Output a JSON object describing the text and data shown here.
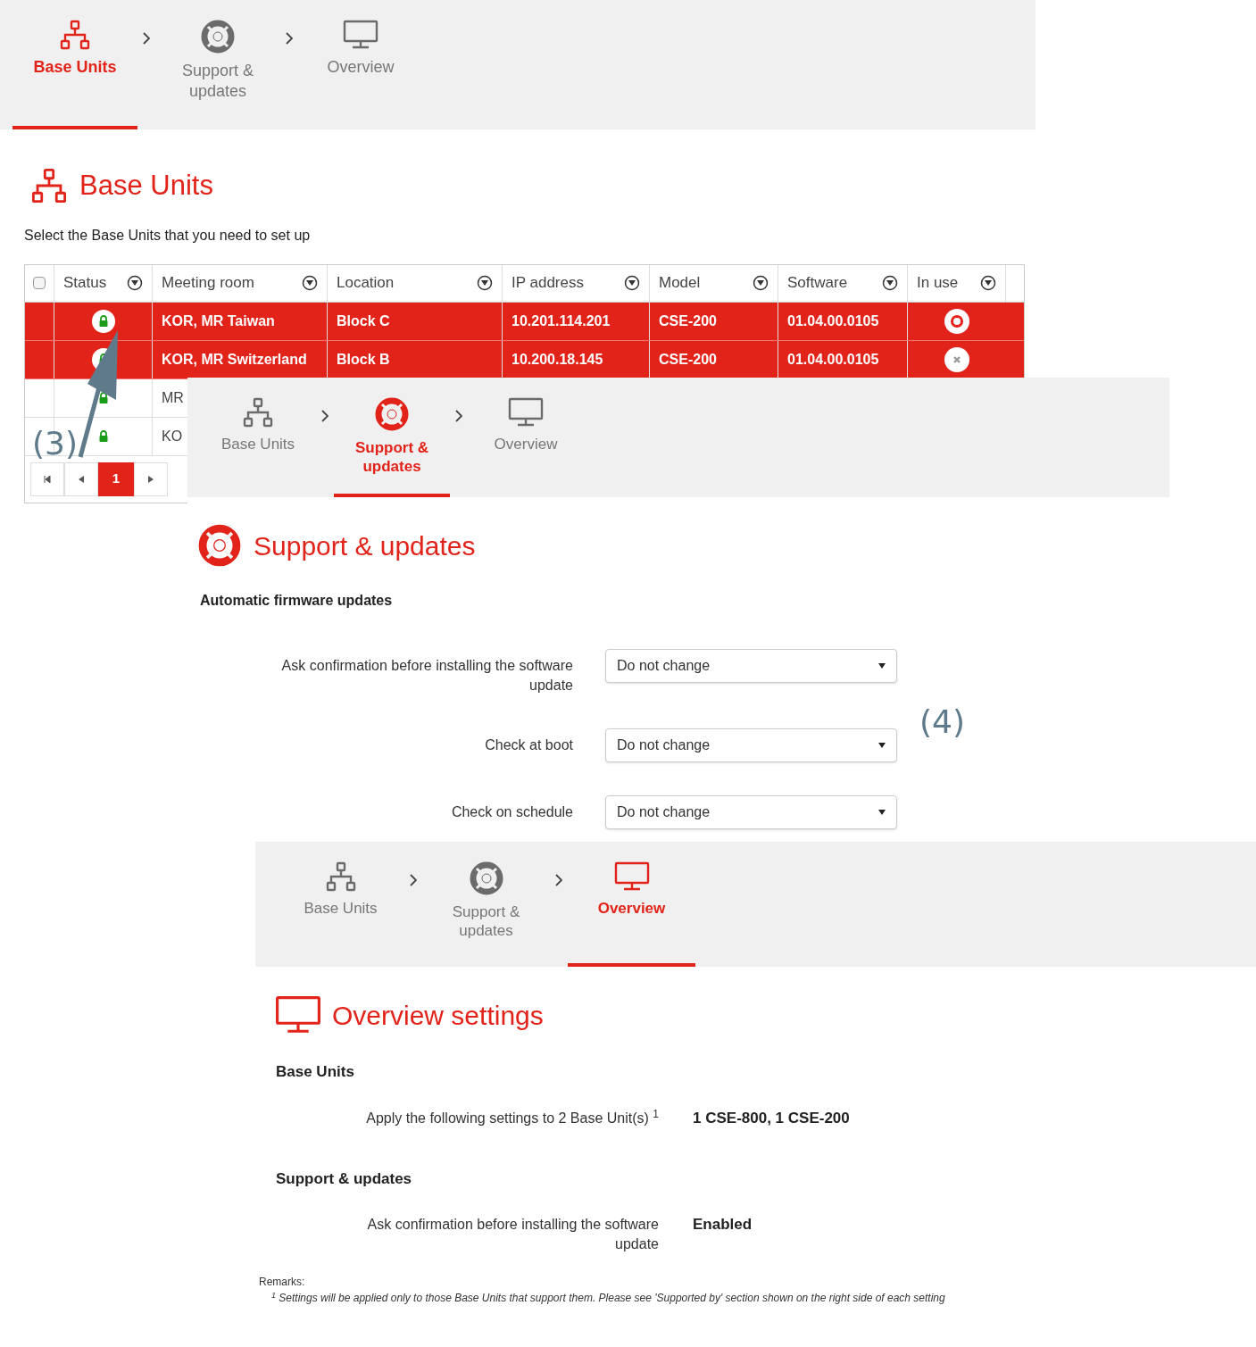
{
  "screen_1": {
    "steps": [
      {
        "label": "Base Units",
        "selected": true
      },
      {
        "label": "Support & updates",
        "selected": false
      },
      {
        "label": "Overview",
        "selected": false
      }
    ],
    "title": "Base Units",
    "subtitle": "Select the Base Units that you need to set up",
    "table": {
      "all_selected": false,
      "columns": [
        "Status",
        "Meeting room",
        "Location",
        "IP address",
        "Model",
        "Software",
        "In use"
      ],
      "rows": [
        {
          "selected": true,
          "in_use": true,
          "cells": [
            "",
            "KOR, MR Taiwan",
            "Block C",
            "10.201.114.201",
            "CSE-200",
            "01.04.00.0105"
          ]
        },
        {
          "selected": true,
          "in_use": false,
          "cells": [
            "",
            "KOR, MR Switzerland",
            "Block B",
            "10.200.18.145",
            "CSE-200",
            "01.04.00.0105"
          ]
        },
        {
          "selected": false,
          "cells": [
            "",
            "MR"
          ]
        },
        {
          "selected": false,
          "cells": [
            "",
            "KO"
          ]
        }
      ]
    },
    "pagination": {
      "current_page": "1"
    }
  },
  "screen_2": {
    "steps": [
      {
        "label": "Base Units",
        "selected": false
      },
      {
        "label": "Support & updates",
        "selected": true
      },
      {
        "label": "Overview",
        "selected": false
      }
    ],
    "title": "Support & updates",
    "section": "Automatic firmware updates",
    "settings": [
      {
        "label": "Ask confirmation before installing the software update",
        "value": "Do not change"
      },
      {
        "label": "Check at boot",
        "value": "Do not change"
      },
      {
        "label": "Check on schedule",
        "value": "Do not change"
      }
    ]
  },
  "screen_3": {
    "steps": [
      {
        "label": "Base Units",
        "selected": false
      },
      {
        "label": "Support & updates",
        "selected": false
      },
      {
        "label": "Overview",
        "selected": true
      }
    ],
    "title": "Overview settings",
    "groups": [
      {
        "heading": "Base Units",
        "items": [
          {
            "label": "Apply the following settings to 2 Base Unit(s) $^{1}$",
            "value": "1 CSE-800, 1 CSE-200"
          }
        ]
      },
      {
        "heading": "Support & updates",
        "items": [
          {
            "label": "Ask confirmation before installing the software update",
            "value": "Enabled"
          }
        ]
      }
    ],
    "remarks": {
      "label": "Remarks:",
      "note": "$^{1}$ Settings will be applied only to those Base Units that support them. Please see 'Supported by' section shown on the right side of each setting"
    }
  },
  "annotations": [
    {
      "label": "(3)"
    },
    {
      "label": "(4)"
    }
  ]
}
